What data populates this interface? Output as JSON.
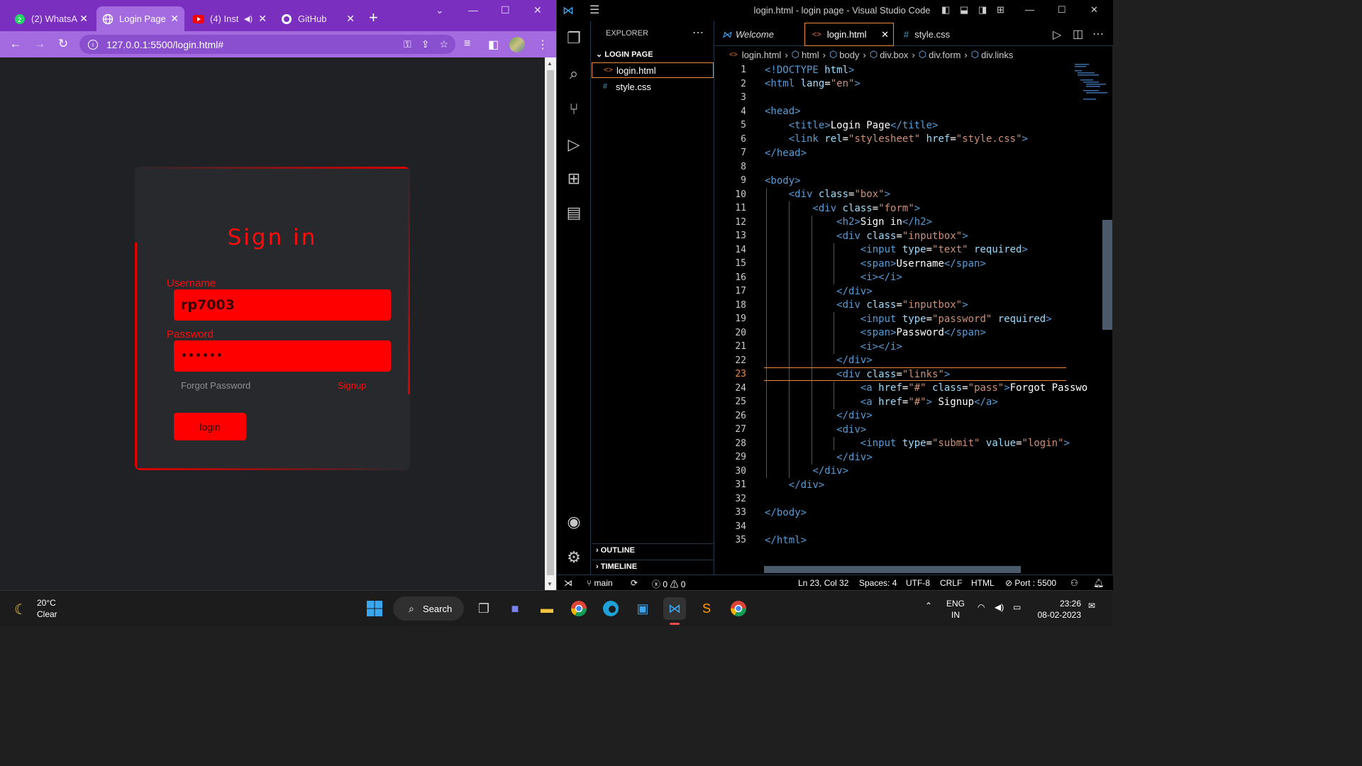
{
  "browser": {
    "tabs": [
      {
        "label": "(2) WhatsA",
        "icon": "whatsapp-icon",
        "active": false
      },
      {
        "label": "Login Page",
        "icon": "globe-icon",
        "active": true
      },
      {
        "label": "(4) Inst",
        "icon": "youtube-icon",
        "active": false
      },
      {
        "label": "GitHub",
        "icon": "github-icon",
        "active": false
      }
    ],
    "url": "127.0.0.1:5500/login.html#",
    "accent_color": "#a46ae0"
  },
  "page": {
    "title": "Sign in",
    "username_label": "Username",
    "username_value": "rp7003",
    "password_label": "Password",
    "password_value": "••••••",
    "forgot_label": "Forgot Password",
    "signup_label": "Signup",
    "login_button": "login",
    "accent_color": "#ff0000"
  },
  "vscode": {
    "window_title": "login.html - login page - Visual Studio Code",
    "explorer_title": "EXPLORER",
    "folder": "LOGIN PAGE",
    "files": [
      "login.html",
      "style.css"
    ],
    "outline": "OUTLINE",
    "timeline": "TIMELINE",
    "tabs": [
      "Welcome",
      "login.html",
      "style.css"
    ],
    "breadcrumb": [
      "login.html",
      "html",
      "body",
      "div.box",
      "div.form",
      "div.links"
    ],
    "status": {
      "branch": "main",
      "problems": "0",
      "warnings": "0",
      "position": "Ln 23, Col 32",
      "spaces": "Spaces: 4",
      "encoding": "UTF-8",
      "eol": "CRLF",
      "language": "HTML",
      "port": "Port : 5500"
    }
  },
  "code_lines": [
    "<!DOCTYPE html>",
    "<html lang=\"en\">",
    "",
    "<head>",
    "    <title>Login Page</title>",
    "    <link rel=\"stylesheet\" href=\"style.css\">",
    "</head>",
    "",
    "<body>",
    "    <div class=\"box\">",
    "        <div class=\"form\">",
    "            <h2>Sign in</h2>",
    "            <div class=\"inputbox\">",
    "                <input type=\"text\" required>",
    "                <span>Username</span>",
    "                <i></i>",
    "            </div>",
    "            <div class=\"inputbox\">",
    "                <input type=\"password\" required>",
    "                <span>Password</span>",
    "                <i></i>",
    "            </div>",
    "            <div class=\"links\">",
    "                <a href=\"#\" class=\"pass\">Forgot Passwo",
    "                <a href=\"#\"> Signup</a>",
    "            </div>",
    "            <div>",
    "                <input type=\"submit\" value=\"login\">",
    "            </div>",
    "        </div>",
    "    </div>",
    "",
    "</body>",
    "",
    "</html>"
  ],
  "taskbar": {
    "temperature": "20°C",
    "weather": "Clear",
    "search_label": "Search",
    "lang_1": "ENG",
    "lang_2": "IN",
    "time": "23:26",
    "date": "08-02-2023"
  }
}
